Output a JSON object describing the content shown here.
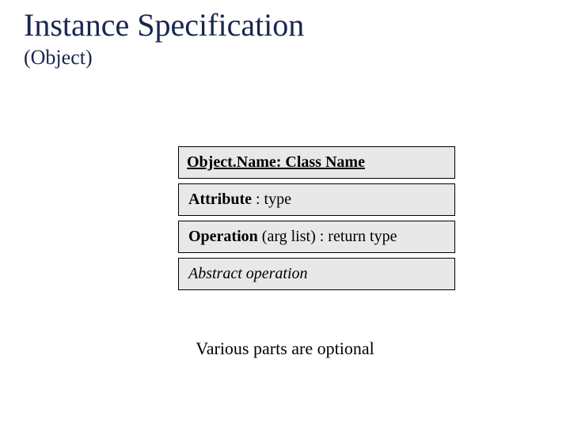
{
  "header": {
    "title": "Instance Specification",
    "subtitle": "(Object)"
  },
  "uml": {
    "name_row": "Object.Name: Class Name",
    "attr_label": "Attribute",
    "attr_rest": " : type",
    "op_label": "Operation",
    "op_rest": " (arg list) : return type",
    "abstract": "Abstract operation"
  },
  "caption": "Various parts are optional"
}
